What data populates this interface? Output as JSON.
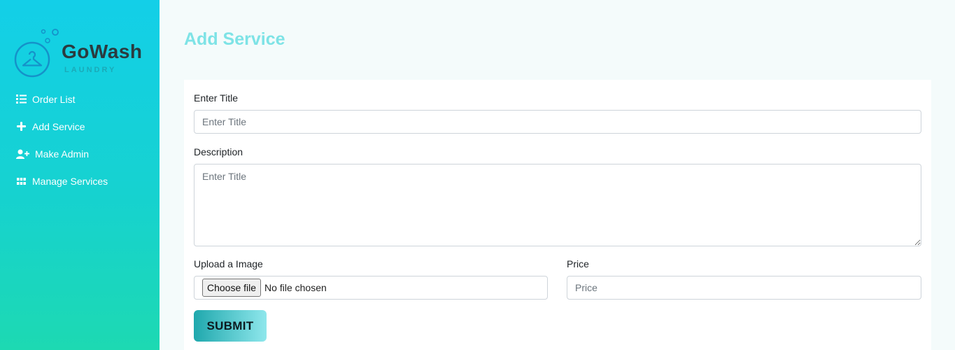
{
  "brand": {
    "name": "GoWash",
    "tagline": "LAUNDRY"
  },
  "sidebar": {
    "items": [
      {
        "label": "Order List",
        "icon": "list-icon"
      },
      {
        "label": "Add Service",
        "icon": "plus-icon"
      },
      {
        "label": "Make Admin",
        "icon": "user-plus-icon"
      },
      {
        "label": "Manage Services",
        "icon": "grid-icon"
      }
    ]
  },
  "page": {
    "title": "Add Service"
  },
  "form": {
    "title_label": "Enter Title",
    "title_placeholder": "Enter Title",
    "description_label": "Description",
    "description_placeholder": "Enter Title",
    "image_label": "Upload a Image",
    "file_button": "Choose file",
    "file_status": "No file chosen",
    "price_label": "Price",
    "price_placeholder": "Price",
    "submit_label": "SUBMIT"
  },
  "colors": {
    "sidebar_top": "#13cfe8",
    "sidebar_bottom": "#1dd9b2",
    "title": "#7ee3e6",
    "brand_text": "#2b3b3f"
  }
}
